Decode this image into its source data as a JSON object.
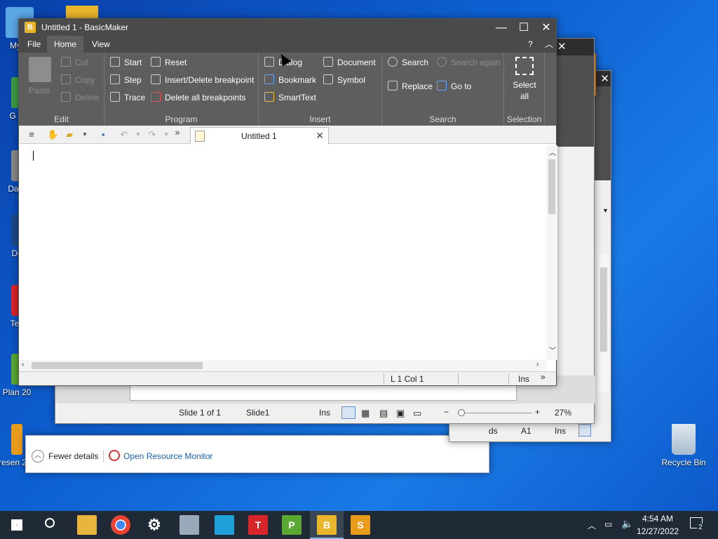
{
  "desktop": {
    "icons": [
      {
        "label": "My C"
      },
      {
        "label": "G C"
      },
      {
        "label": "Data"
      },
      {
        "label": "Do"
      },
      {
        "label": "Tex"
      },
      {
        "label": "Plan 20"
      },
      {
        "label": "Presen 2021"
      }
    ],
    "recycle_bin": "Recycle Bin"
  },
  "background_windows": {
    "presentations": {
      "status_slide": "Slide 1 of 1",
      "status_name": "Slide1",
      "status_ins": "Ins",
      "zoom": "27%"
    },
    "planmaker": {
      "status_ds": "ds",
      "status_cell": "A1",
      "status_ins": "Ins"
    },
    "task_manager": {
      "fewer_details": "Fewer details",
      "resource_monitor": "Open Resource Monitor"
    }
  },
  "app": {
    "title": "Untitled 1 - BasicMaker",
    "menu": [
      "File",
      "Home",
      "View"
    ],
    "help": "?",
    "ribbon": {
      "edit": {
        "label": "Edit",
        "paste": "Paste",
        "cut": "Cut",
        "copy": "Copy",
        "delete": "Delete"
      },
      "program": {
        "label": "Program",
        "start": "Start",
        "step": "Step",
        "trace": "Trace",
        "reset": "Reset",
        "insert_bp": "Insert/Delete breakpoint",
        "delete_bp": "Delete all breakpoints"
      },
      "insert": {
        "label": "Insert",
        "dialog": "Dialog",
        "bookmark": "Bookmark",
        "smarttext": "SmartText",
        "document": "Document",
        "symbol": "Symbol"
      },
      "search": {
        "label": "Search",
        "search": "Search",
        "search_again": "Search again",
        "replace": "Replace",
        "goto": "Go to"
      },
      "selection": {
        "label": "Selection",
        "select_all": "Select all"
      }
    },
    "tab_title": "Untitled 1",
    "status": {
      "position": "L 1 Col 1",
      "mode": "Ins"
    }
  },
  "taskbar": {
    "time": "4:54 AM",
    "date": "12/27/2022",
    "notifications": "2"
  }
}
